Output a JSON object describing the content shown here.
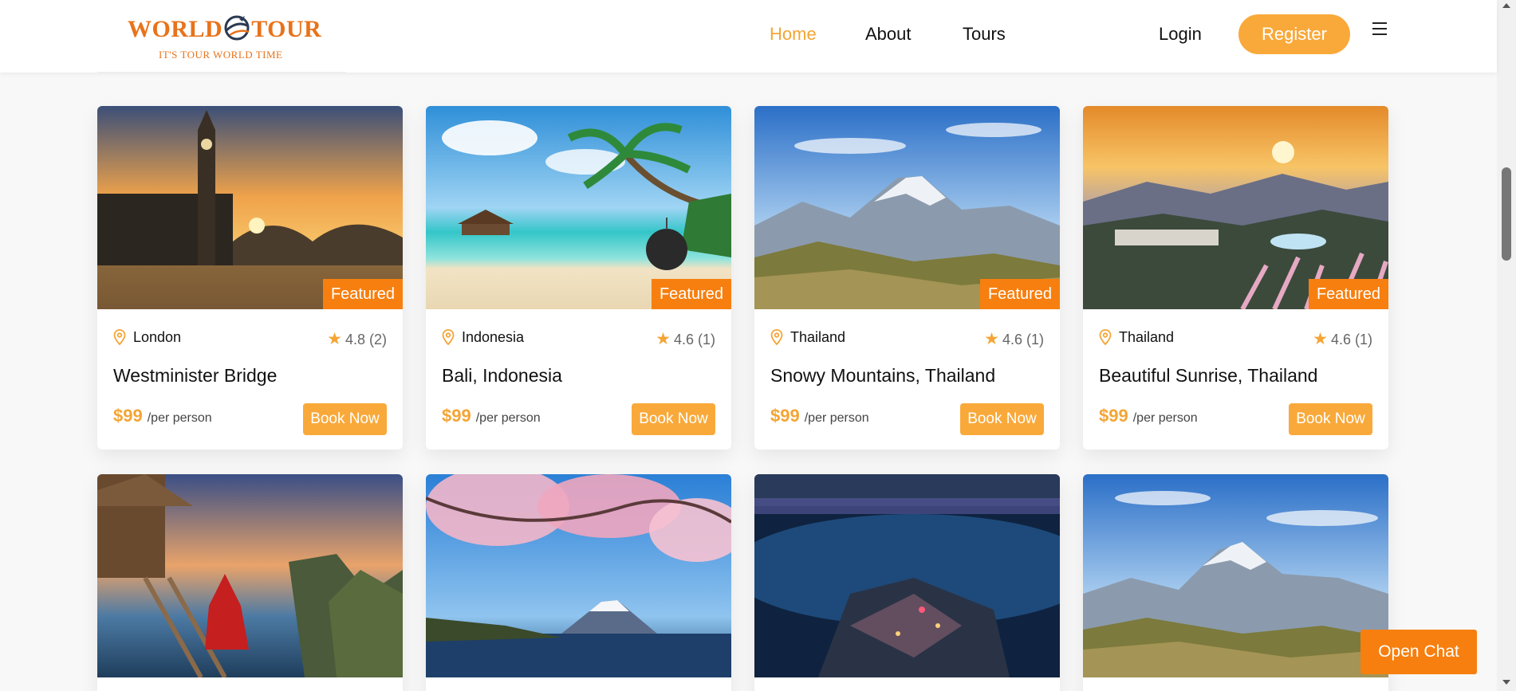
{
  "header": {
    "logo_title_part1": "WORLD",
    "logo_title_part2": "TOUR",
    "logo_tagline": "IT'S TOUR WORLD TIME",
    "nav": {
      "home": "Home",
      "about": "About",
      "tours": "Tours",
      "login": "Login"
    },
    "register_label": "Register",
    "menu_icon": "hamburger-icon"
  },
  "colors": {
    "accent": "#f9a93a",
    "badge": "#f77f0f",
    "active_nav": "#f4a535"
  },
  "tours": [
    {
      "location": "London",
      "rating": "4.8 (2)",
      "title": "Westminister Bridge",
      "price": "$99",
      "per": "/per person",
      "badge": "Featured",
      "book": "Book Now"
    },
    {
      "location": "Indonesia",
      "rating": "4.6 (1)",
      "title": "Bali, Indonesia",
      "price": "$99",
      "per": "/per person",
      "badge": "Featured",
      "book": "Book Now"
    },
    {
      "location": "Thailand",
      "rating": "4.6 (1)",
      "title": "Snowy Mountains, Thailand",
      "price": "$99",
      "per": "/per person",
      "badge": "Featured",
      "book": "Book Now"
    },
    {
      "location": "Thailand",
      "rating": "4.6 (1)",
      "title": "Beautiful Sunrise, Thailand",
      "price": "$99",
      "per": "/per person",
      "badge": "Featured",
      "book": "Book Now"
    }
  ],
  "chat": {
    "label": "Open Chat"
  }
}
